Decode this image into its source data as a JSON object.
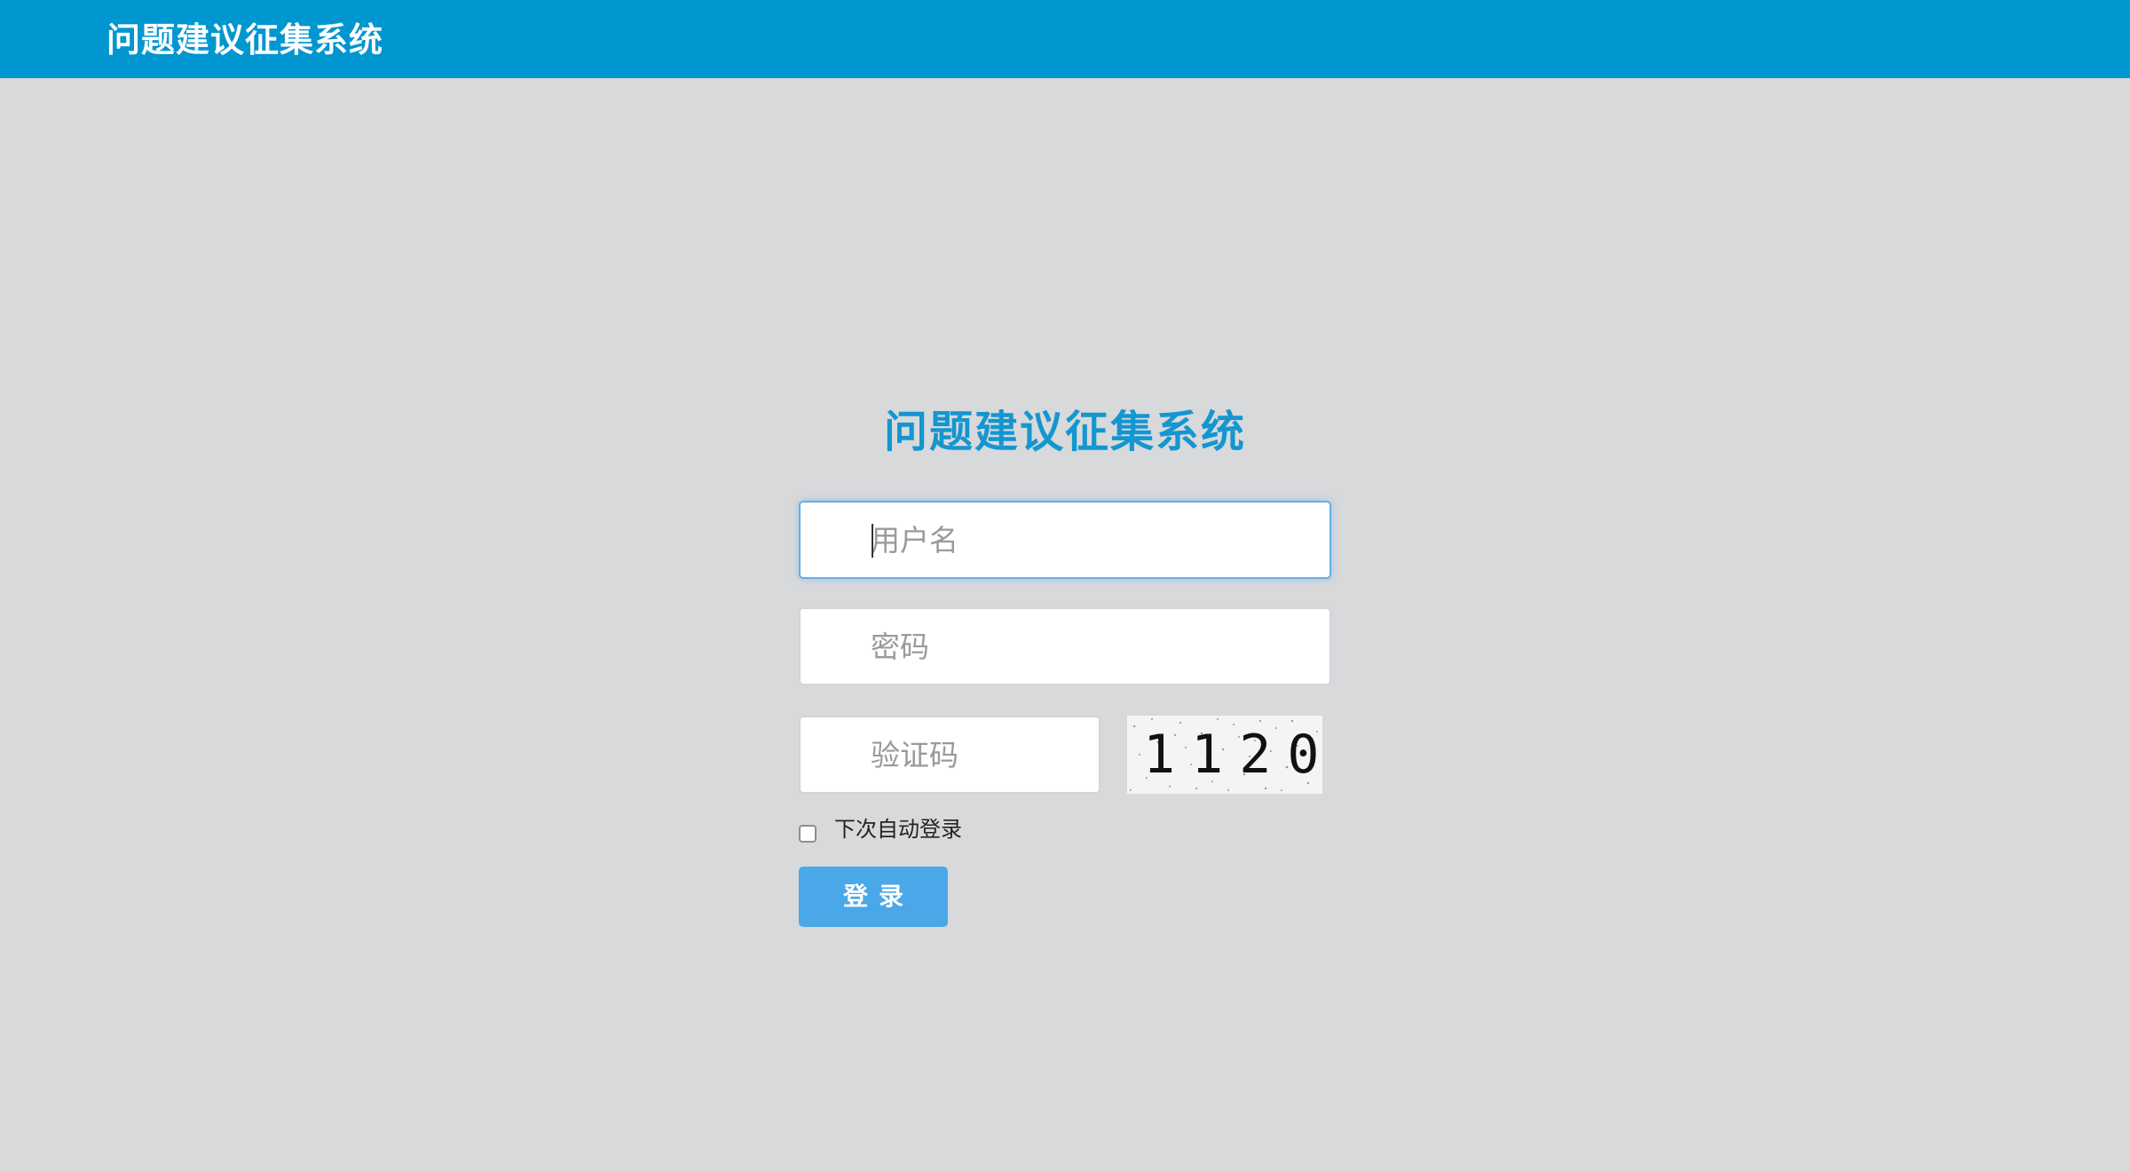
{
  "header": {
    "title": "问题建议征集系统",
    "background_color": "#0096d0"
  },
  "login": {
    "title": "问题建议征集系统",
    "title_color": "#1496d0",
    "username_placeholder": "用户名",
    "username_value": "",
    "password_placeholder": "密码",
    "password_value": "",
    "captcha_placeholder": "验证码",
    "captcha_value": "",
    "captcha_image_text": "1120",
    "remember_label": "下次自动登录",
    "remember_checked": false,
    "submit_label": "登录",
    "submit_color": "#4aa8e8"
  },
  "page": {
    "background_color": "#d8d9db"
  }
}
